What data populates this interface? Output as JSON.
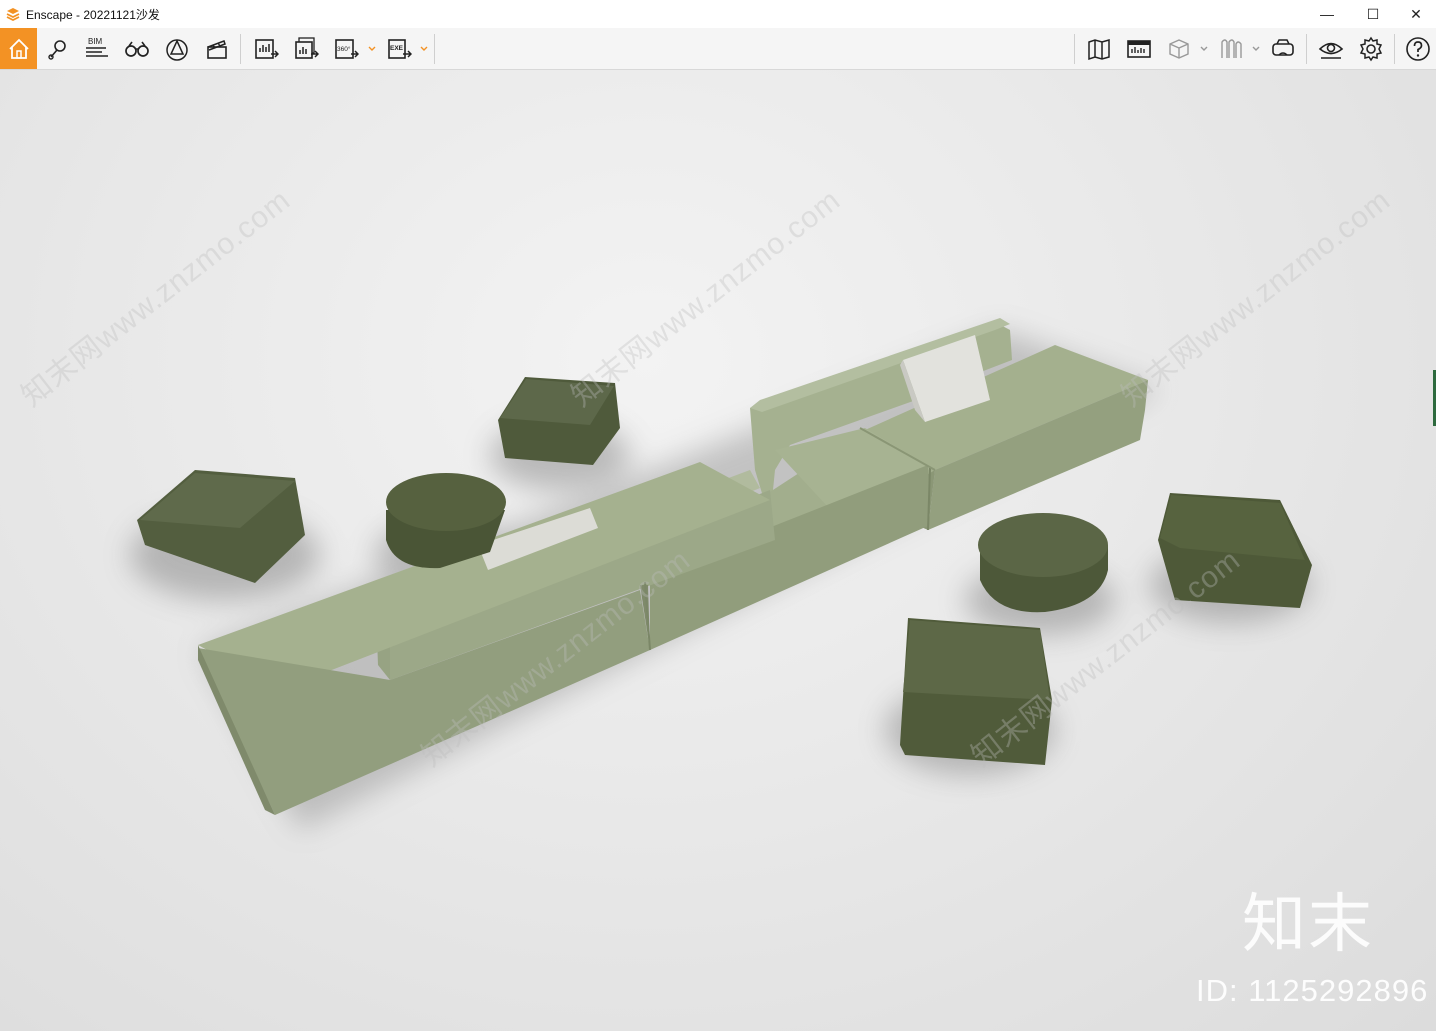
{
  "window": {
    "title": "Enscape - 20221121沙发",
    "minimize_glyph": "—",
    "maximize_glyph": "☐",
    "close_glyph": "✕"
  },
  "toolbar": {
    "left": [
      {
        "name": "home-icon"
      },
      {
        "name": "location-pin-icon"
      },
      {
        "name": "bim-info-icon",
        "label": "BIM"
      },
      {
        "name": "binoculars-icon"
      },
      {
        "name": "asset-library-icon"
      },
      {
        "name": "clapperboard-icon"
      },
      {
        "name": "render-image-icon"
      },
      {
        "name": "batch-render-icon"
      },
      {
        "name": "render-360-icon",
        "label": "360°"
      },
      {
        "name": "export-exe-icon",
        "label": "EXE"
      }
    ],
    "right": [
      {
        "name": "map-icon"
      },
      {
        "name": "site-context-icon"
      },
      {
        "name": "cube-view-icon"
      },
      {
        "name": "material-icon"
      },
      {
        "name": "vr-headset-icon"
      },
      {
        "name": "visual-settings-eye-icon"
      },
      {
        "name": "settings-gear-icon"
      },
      {
        "name": "help-icon"
      }
    ]
  },
  "watermark": {
    "brand": "知末",
    "id_text": "ID: 1125292896",
    "diagonal_text": "知末网www.znzmo.com"
  },
  "colors": {
    "accent": "#f39224",
    "sofa_light": "#94a17f",
    "sofa_top": "#9eab89",
    "ottoman_dark": "#535e3f",
    "pillow": "#e1e1dc"
  }
}
